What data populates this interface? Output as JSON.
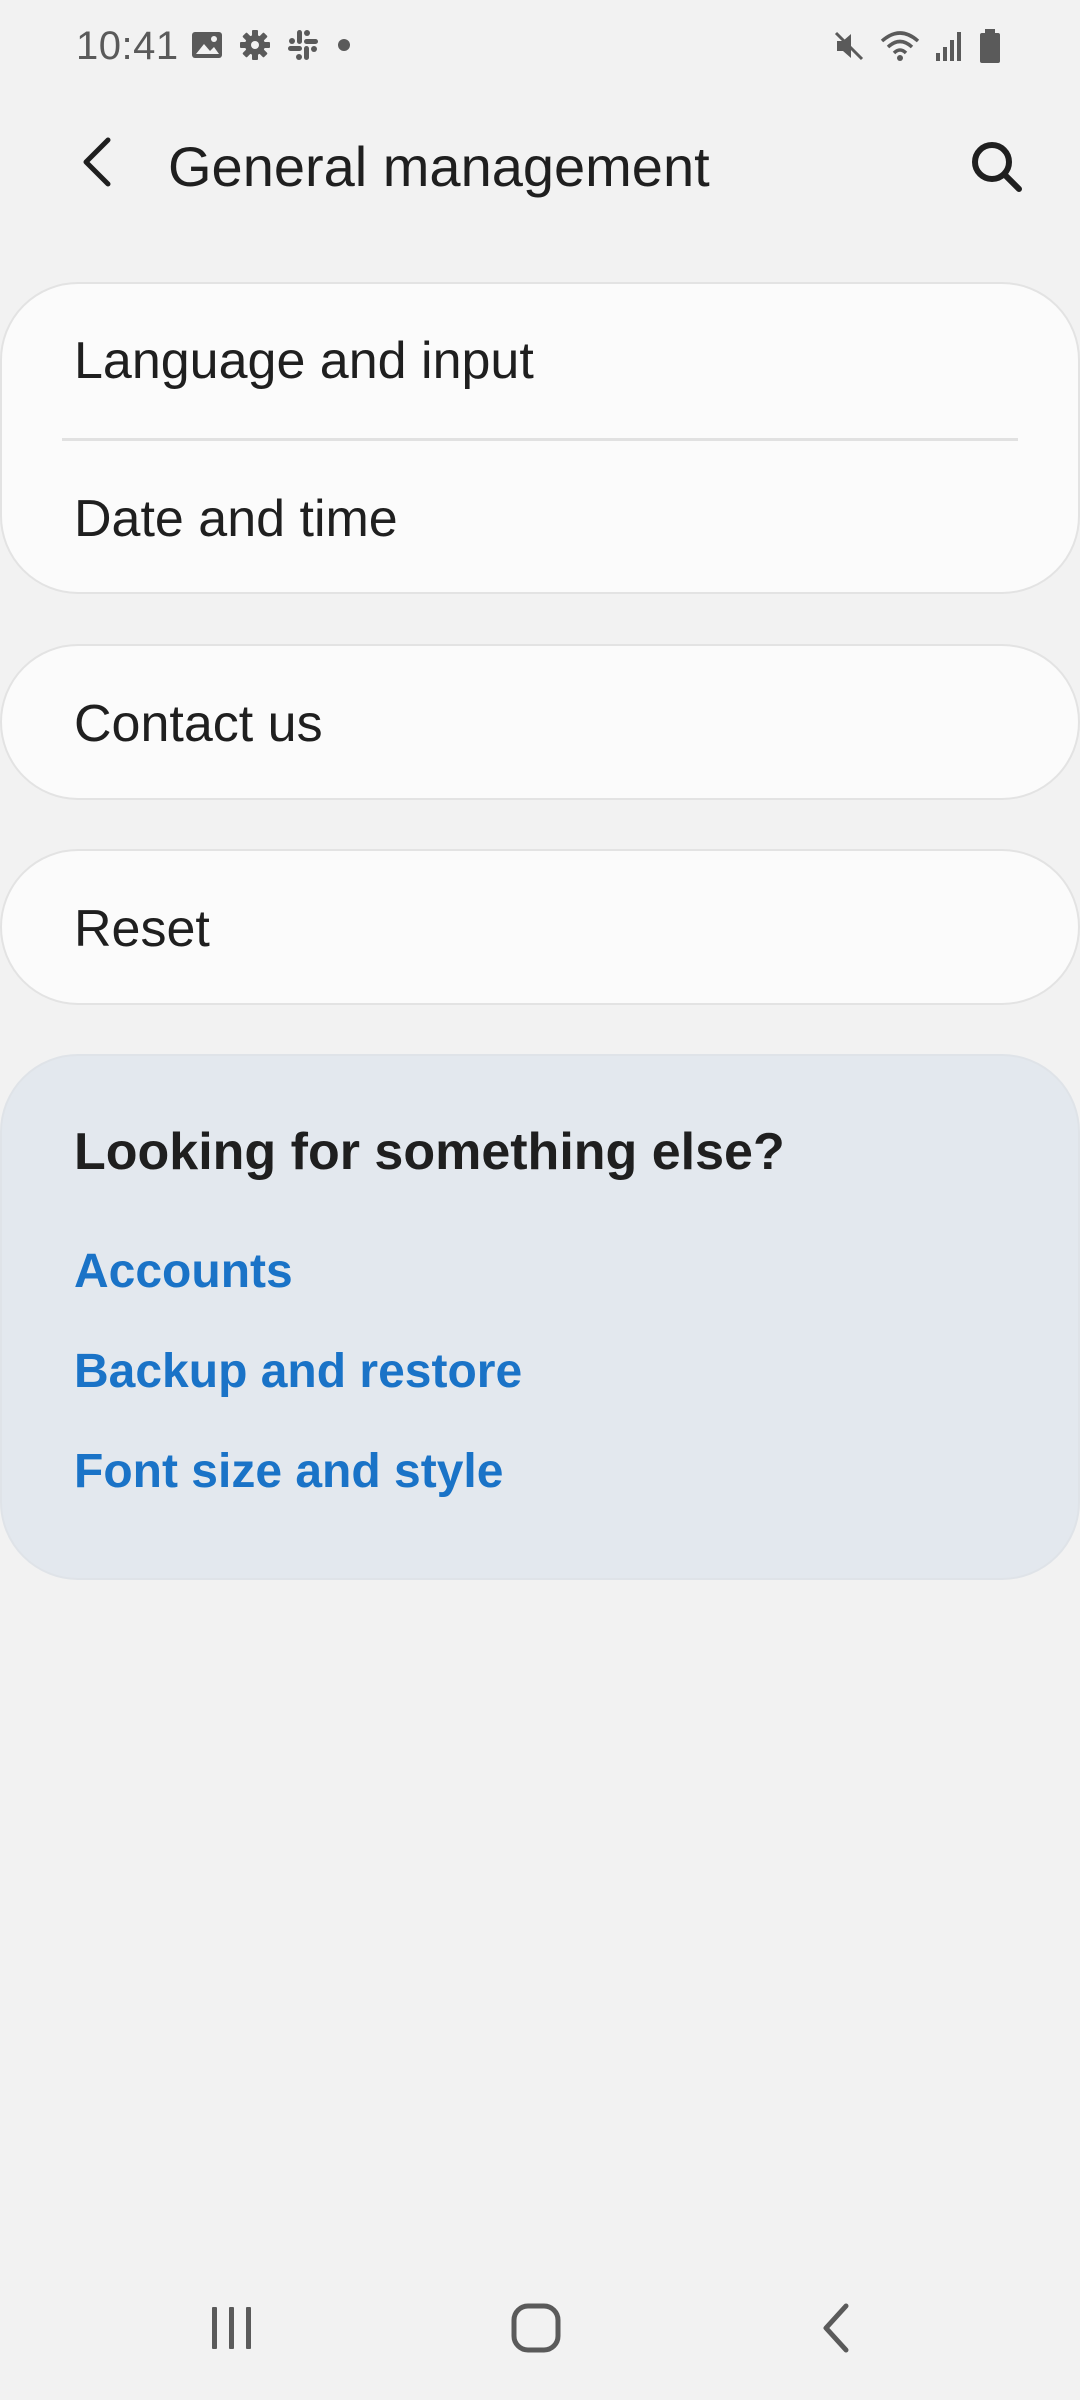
{
  "status_bar": {
    "time": "10:41",
    "left_icons": [
      "image-icon",
      "settings-gear-icon",
      "slack-icon",
      "notification-dot-icon"
    ],
    "right_icons": [
      "mute-icon",
      "wifi-icon",
      "signal-icon",
      "battery-icon"
    ]
  },
  "app_bar": {
    "title": "General management",
    "back_icon": "back-arrow-icon",
    "search_icon": "search-icon"
  },
  "settings": {
    "group_1": [
      {
        "label": "Language and input"
      },
      {
        "label": "Date and time"
      }
    ],
    "group_2": [
      {
        "label": "Contact us"
      }
    ],
    "group_3": [
      {
        "label": "Reset"
      }
    ]
  },
  "suggestions": {
    "title": "Looking for something else?",
    "links": [
      {
        "label": "Accounts"
      },
      {
        "label": "Backup and restore"
      },
      {
        "label": "Font size and style"
      }
    ]
  },
  "nav_bar": {
    "icons": [
      "recents-icon",
      "home-icon",
      "back-icon"
    ]
  },
  "colors": {
    "background": "#f2f2f2",
    "card": "#fbfbfb",
    "suggestion_card": "#e3e8ee",
    "link": "#1a73c7",
    "text": "#1f1f1f"
  }
}
